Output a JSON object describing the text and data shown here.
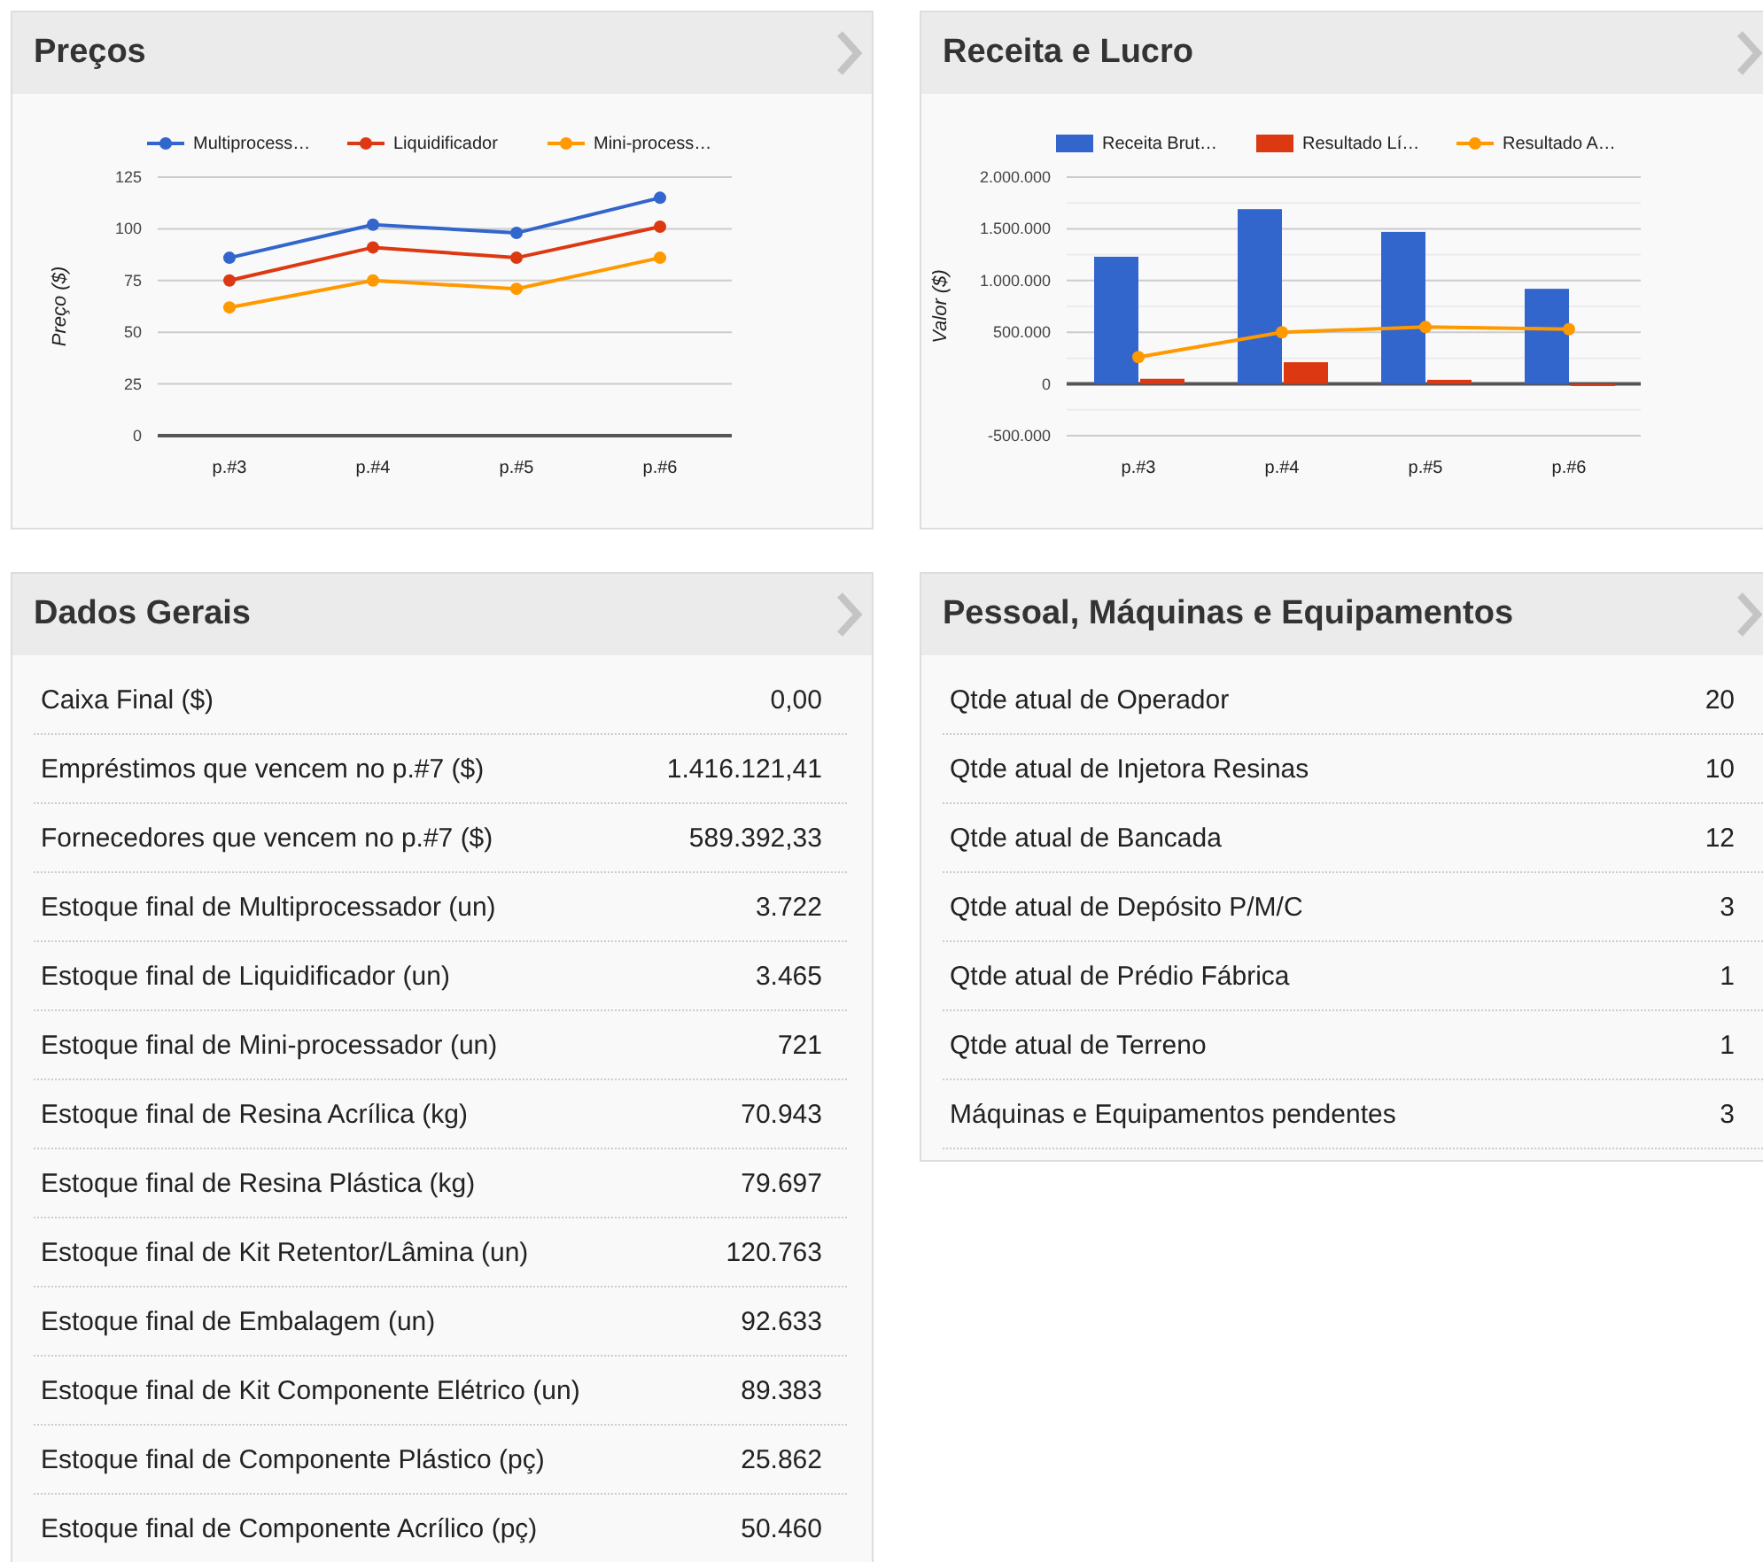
{
  "panels": [
    {
      "title": "Preços",
      "kind": "chart",
      "chart_data": {
        "type": "line",
        "grid": true,
        "legend": true,
        "ylabel": "Preço ($)",
        "categories": [
          "p.#3",
          "p.#4",
          "p.#5",
          "p.#6"
        ],
        "ylim": [
          0,
          125
        ],
        "yticks": [
          0,
          25,
          50,
          75,
          100,
          125
        ],
        "series": [
          {
            "name": "Multiprocess…",
            "color": "#3366cc",
            "type": "line",
            "marker": true,
            "values": [
              86,
              102,
              98,
              115
            ]
          },
          {
            "name": "Liquidificador",
            "color": "#dc3912",
            "type": "line",
            "marker": true,
            "values": [
              75,
              91,
              86,
              101
            ]
          },
          {
            "name": "Mini-process…",
            "color": "#ff9900",
            "type": "line",
            "marker": true,
            "values": [
              62,
              75,
              71,
              86
            ]
          }
        ]
      }
    },
    {
      "title": "Receita e Lucro",
      "kind": "chart",
      "chart_data": {
        "type": "bar",
        "stacked": false,
        "grid": true,
        "legend": true,
        "ylabel": "Valor ($)",
        "categories": [
          "p.#3",
          "p.#4",
          "p.#5",
          "p.#6"
        ],
        "ylim": [
          -500000,
          2000000
        ],
        "yticks": [
          {
            "value": -500000,
            "label": "-500.000"
          },
          {
            "value": 0,
            "label": "0"
          },
          {
            "value": 500000,
            "label": "500.000"
          },
          {
            "value": 1000000,
            "label": "1.000.000"
          },
          {
            "value": 1500000,
            "label": "1.500.000"
          },
          {
            "value": 2000000,
            "label": "2.000.000"
          }
        ],
        "series": [
          {
            "name": "Receita Brut…",
            "color": "#3366cc",
            "type": "bar",
            "values": [
              1230000,
              1690000,
              1470000,
              920000
            ]
          },
          {
            "name": "Resultado Lí…",
            "color": "#dc3912",
            "type": "bar",
            "values": [
              50000,
              210000,
              40000,
              -20000
            ]
          },
          {
            "name": "Resultado A…",
            "color": "#ff9900",
            "type": "line",
            "marker": true,
            "values": [
              260000,
              500000,
              550000,
              530000
            ]
          }
        ]
      }
    },
    {
      "title": "Dados Gerais",
      "kind": "list",
      "rows": [
        {
          "label": "Caixa Final ($)",
          "value": "0,00"
        },
        {
          "label": "Empréstimos que vencem no p.#7 ($)",
          "value": "1.416.121,41"
        },
        {
          "label": "Fornecedores que vencem no p.#7 ($)",
          "value": "589.392,33"
        },
        {
          "label": "Estoque final de Multiprocessador (un)",
          "value": "3.722"
        },
        {
          "label": "Estoque final de Liquidificador (un)",
          "value": "3.465"
        },
        {
          "label": "Estoque final de Mini-processador (un)",
          "value": "721"
        },
        {
          "label": "Estoque final de Resina Acrílica (kg)",
          "value": "70.943"
        },
        {
          "label": "Estoque final de Resina Plástica (kg)",
          "value": "79.697"
        },
        {
          "label": "Estoque final de Kit Retentor/Lâmina (un)",
          "value": "120.763"
        },
        {
          "label": "Estoque final de Embalagem (un)",
          "value": "92.633"
        },
        {
          "label": "Estoque final de Kit Componente Elétrico (un)",
          "value": "89.383"
        },
        {
          "label": "Estoque final de Componente Plástico (pç)",
          "value": "25.862"
        },
        {
          "label": "Estoque final de Componente Acrílico (pç)",
          "value": "50.460"
        }
      ]
    },
    {
      "title": "Pessoal, Máquinas e Equipamentos",
      "kind": "list",
      "rows": [
        {
          "label": "Qtde atual de Operador",
          "value": "20"
        },
        {
          "label": "Qtde atual de Injetora Resinas",
          "value": "10"
        },
        {
          "label": "Qtde atual de Bancada",
          "value": "12"
        },
        {
          "label": "Qtde atual de Depósito P/M/C",
          "value": "3"
        },
        {
          "label": "Qtde atual de Prédio Fábrica",
          "value": "1"
        },
        {
          "label": "Qtde atual de Terreno",
          "value": "1"
        },
        {
          "label": "Máquinas e Equipamentos pendentes",
          "value": "3"
        }
      ]
    }
  ]
}
